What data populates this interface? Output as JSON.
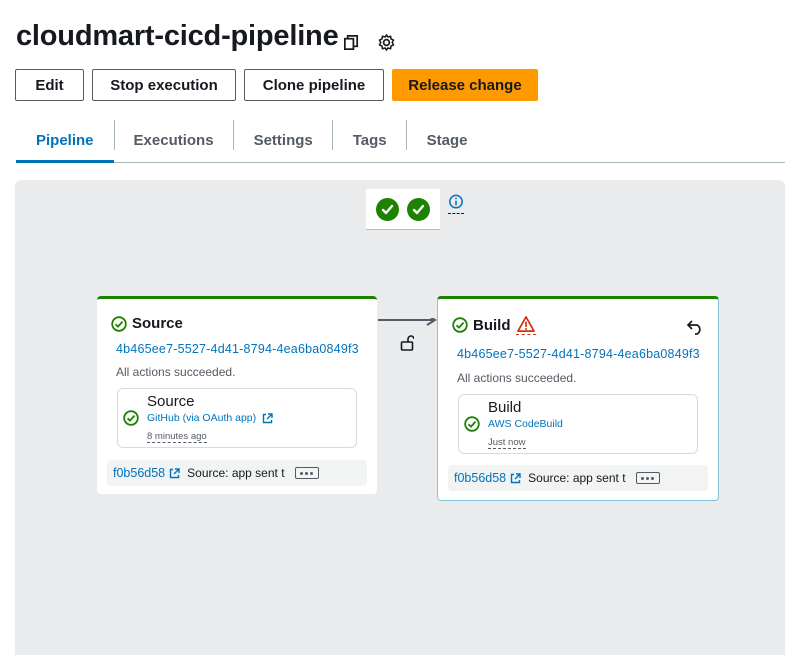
{
  "header": {
    "title": "cloudmart-cicd-pipeline",
    "icons": [
      "copy-icon",
      "gear-icon"
    ]
  },
  "actions": {
    "edit": "Edit",
    "stop": "Stop execution",
    "clone": "Clone pipeline",
    "release": "Release change"
  },
  "tabs": [
    {
      "label": "Pipeline",
      "active": true
    },
    {
      "label": "Executions",
      "active": false
    },
    {
      "label": "Settings",
      "active": false
    },
    {
      "label": "Tags",
      "active": false
    },
    {
      "label": "Stage",
      "active": false
    }
  ],
  "colors": {
    "success": "#1d8102",
    "link": "#0073bb",
    "primary": "#ff9900",
    "warning": "#d13212",
    "canvas": "#e9ebed"
  },
  "stages": {
    "source": {
      "name": "Source",
      "execution_id": "4b465ee7-5527-4d41-8794-4ea6ba0849f3",
      "status_message": "All actions succeeded.",
      "action": {
        "name": "Source",
        "provider": "GitHub (via OAuth app)",
        "time": "8 minutes ago"
      },
      "commit": {
        "hash": "f0b56d58",
        "message": "Source: app sent t"
      }
    },
    "build": {
      "name": "Build",
      "execution_id": "4b465ee7-5527-4d41-8794-4ea6ba0849f3",
      "status_message": "All actions succeeded.",
      "action": {
        "name": "Build",
        "provider": "AWS CodeBuild",
        "time": "Just now"
      },
      "commit": {
        "hash": "f0b56d58",
        "message": "Source: app sent t"
      }
    }
  }
}
